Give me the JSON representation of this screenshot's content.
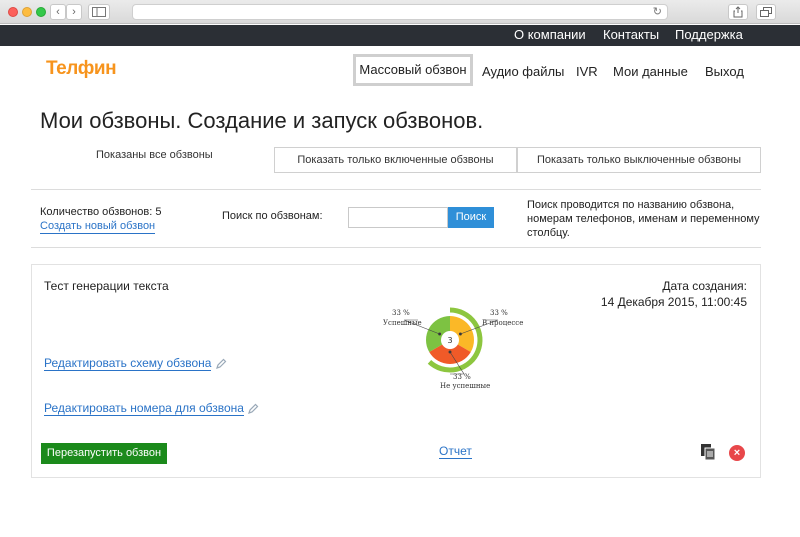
{
  "browser": {
    "back_glyph": "‹",
    "forward_glyph": "›",
    "reload_glyph": "↻"
  },
  "topbar": {
    "items": [
      "О компании",
      "Контакты",
      "Поддержка"
    ]
  },
  "header": {
    "logo": "Телфин",
    "nav": {
      "active": "Массовый обзвон",
      "items": [
        "Аудио файлы",
        "IVR",
        "Мои данные",
        "Выход"
      ]
    }
  },
  "page": {
    "title": "Мои обзвоны. Создание и запуск обзвонов."
  },
  "filters": {
    "all": "Показаны все обзвоны",
    "enabled": "Показать только включенные обзвоны",
    "disabled": "Показать только выключенные обзвоны"
  },
  "stats": {
    "count_label": "Количество обзвонов: 5",
    "create_link": "Создать новый обзвон",
    "search_label": "Поиск по обзвонам:",
    "search_value": "",
    "search_button": "Поиск",
    "search_hint": "Поиск проводится по названию обзвона, номерам телефонов, именам и переменному столбцу."
  },
  "campaign": {
    "name": "Тест генерации текста",
    "date_label": "Дата создания:",
    "date_value": "14 Декабря 2015, 11:00:45",
    "edit_scheme": "Редактировать схему обзвона",
    "edit_numbers": "Редактировать номера для обзвона",
    "restart_button": "Перезапустить обзвон",
    "report_link": "Отчет",
    "delete_glyph": "×"
  },
  "chart_data": {
    "type": "pie",
    "center_label": "3",
    "categories": [
      "Успешные",
      "В процессе",
      "Не успешные"
    ],
    "values": [
      33,
      33,
      33
    ],
    "value_labels": [
      "33 %",
      "33 %",
      "33 %"
    ],
    "colors": [
      "#7dc242",
      "#fbb827",
      "#f05a28"
    ],
    "outer_ring_color": "#8dc63f"
  },
  "colors": {
    "brand": "#f7941d",
    "link": "#2a73c7",
    "search_button": "#2f8fd8",
    "restart_button": "#1b8a1b",
    "delete": "#e8474a"
  }
}
